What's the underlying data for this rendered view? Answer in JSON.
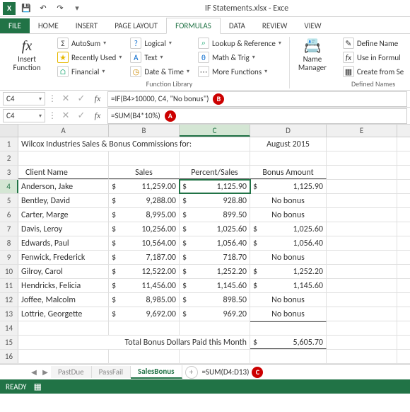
{
  "window": {
    "title": "IF Statements.xlsx - Exce"
  },
  "tabs": {
    "file": "FILE",
    "home": "HOME",
    "insert": "INSERT",
    "page_layout": "PAGE LAYOUT",
    "formulas": "FORMULAS",
    "data": "DATA",
    "review": "REVIEW",
    "view": "VIEW"
  },
  "ribbon": {
    "insert_function": "Insert Function",
    "autosum": "AutoSum",
    "recently_used": "Recently Used",
    "financial": "Financial",
    "logical": "Logical",
    "text": "Text",
    "date_time": "Date & Time",
    "lookup_ref": "Lookup & Reference",
    "math_trig": "Math & Trig",
    "more_functions": "More Functions",
    "function_library": "Function Library",
    "name_manager": "Name Manager",
    "define_name": "Define Name",
    "use_in_formula": "Use in Formul",
    "create_from": "Create from Se",
    "defined_names": "Defined Names"
  },
  "formula_bar_b": {
    "ref": "C4",
    "formula": "=IF(B4>10000, C4, \"No bonus\")",
    "badge": "B"
  },
  "formula_bar_a": {
    "ref": "C4",
    "formula": "=SUM(B4*10%)",
    "badge": "A"
  },
  "columns": [
    "A",
    "B",
    "C",
    "D",
    "E"
  ],
  "sheet": {
    "row1_title": "Wilcox Industries Sales & Bonus Commissions for:",
    "row1_date": "August 2015",
    "h_client": "Client Name",
    "h_sales": "Sales",
    "h_percent": "Percent/Sales",
    "h_bonus": "Bonus Amount",
    "rows": [
      {
        "n": 4,
        "name": "Anderson, Jake",
        "sales": "11,259.00",
        "percent": "1,125.90",
        "bonus": "1,125.90",
        "bonus_money": true
      },
      {
        "n": 5,
        "name": "Bentley, David",
        "sales": "9,288.00",
        "percent": "928.80",
        "bonus": "No bonus",
        "bonus_money": false
      },
      {
        "n": 6,
        "name": "Carter, Marge",
        "sales": "8,995.00",
        "percent": "899.50",
        "bonus": "No bonus",
        "bonus_money": false
      },
      {
        "n": 7,
        "name": "Davis, Leroy",
        "sales": "10,256.00",
        "percent": "1,025.60",
        "bonus": "1,025.60",
        "bonus_money": true
      },
      {
        "n": 8,
        "name": "Edwards, Paul",
        "sales": "10,564.00",
        "percent": "1,056.40",
        "bonus": "1,056.40",
        "bonus_money": true
      },
      {
        "n": 9,
        "name": "Fenwick, Frederick",
        "sales": "7,187.00",
        "percent": "718.70",
        "bonus": "No bonus",
        "bonus_money": false
      },
      {
        "n": 10,
        "name": "Gilroy, Carol",
        "sales": "12,522.00",
        "percent": "1,252.20",
        "bonus": "1,252.20",
        "bonus_money": true
      },
      {
        "n": 11,
        "name": "Hendricks, Felicia",
        "sales": "11,456.00",
        "percent": "1,145.60",
        "bonus": "1,145.60",
        "bonus_money": true
      },
      {
        "n": 12,
        "name": "Joffee, Malcolm",
        "sales": "8,985.00",
        "percent": "898.50",
        "bonus": "No bonus",
        "bonus_money": false
      },
      {
        "n": 13,
        "name": "Lottrie, Georgette",
        "sales": "9,692.00",
        "percent": "969.20",
        "bonus": "No bonus",
        "bonus_money": false
      }
    ],
    "total_label": "Total Bonus Dollars Paid this Month",
    "total_value": "5,605.70",
    "currency": "$"
  },
  "sheet_tabs": {
    "t1": "PastDue",
    "t2": "PassFail",
    "t3": "SalesBonus",
    "footer_formula": "=SUM(D4:D13)",
    "badge": "C"
  },
  "status": {
    "ready": "READY"
  }
}
